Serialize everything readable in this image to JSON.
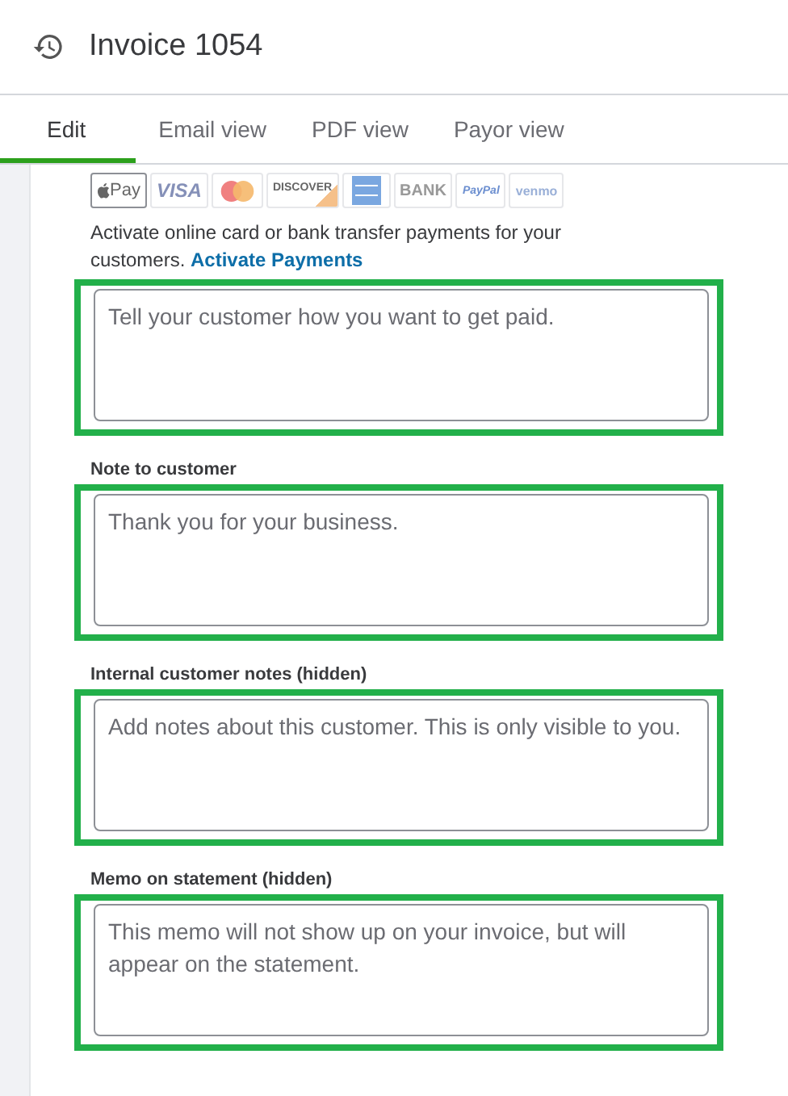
{
  "header": {
    "title": "Invoice 1054"
  },
  "tabs": [
    {
      "label": "Edit",
      "selected": true
    },
    {
      "label": "Email view",
      "selected": false
    },
    {
      "label": "PDF view",
      "selected": false
    },
    {
      "label": "Payor view",
      "selected": false
    }
  ],
  "payment_methods": [
    {
      "kind": "applepay",
      "label": "Pay",
      "selected": true
    },
    {
      "kind": "visa",
      "label": "VISA",
      "selected": false
    },
    {
      "kind": "mastercard",
      "selected": false
    },
    {
      "kind": "discover",
      "label": "DISCOVER",
      "selected": false
    },
    {
      "kind": "amex",
      "selected": false
    },
    {
      "kind": "bank",
      "label": "BANK",
      "selected": false
    },
    {
      "kind": "paypal",
      "label": "PayPal",
      "selected": false
    },
    {
      "kind": "venmo",
      "label": "venmo",
      "selected": false
    }
  ],
  "payments_note": {
    "text": "Activate online card or bank transfer payments for your customers.",
    "link": "Activate Payments"
  },
  "fields": [
    {
      "placeholder": "Tell your customer how you want to get paid.",
      "highlighted": true
    },
    {
      "label": "Note to customer",
      "value": "Thank you for your business.",
      "highlighted": true
    },
    {
      "label": "Internal customer notes (hidden)",
      "placeholder": "Add notes about this customer. This is only visible to you.",
      "highlighted": true
    },
    {
      "label": "Memo on statement (hidden)",
      "placeholder": "This memo will not show up on your invoice, but will appear on the statement.",
      "highlighted": true
    }
  ]
}
